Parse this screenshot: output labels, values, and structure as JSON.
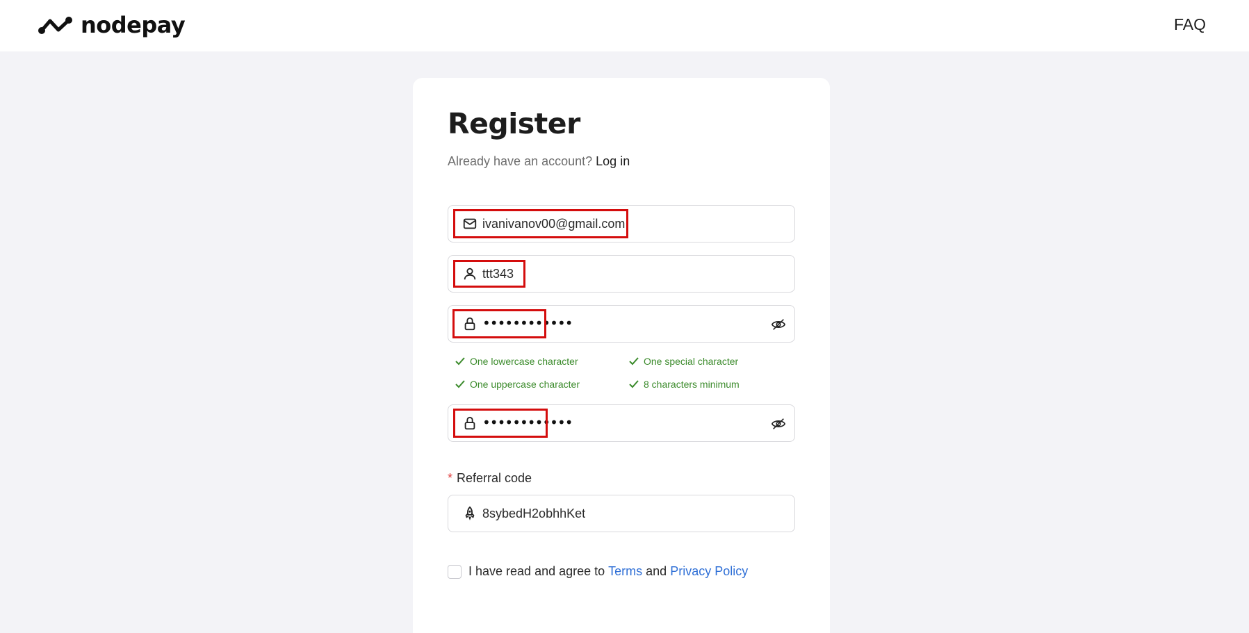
{
  "header": {
    "logo_text": "nodepay",
    "faq_label": "FAQ"
  },
  "form": {
    "title": "Register",
    "subtitle_text": "Already have an account? ",
    "login_link": "Log in",
    "email_value": "ivanivanov00@gmail.com",
    "username_value": "ttt343",
    "password_value": "••••••••••••",
    "confirm_password_value": "••••••••••••",
    "requirements": [
      "One lowercase character",
      "One special character",
      "One uppercase character",
      "8 characters minimum"
    ],
    "referral_required_mark": "*",
    "referral_label": "Referral code",
    "referral_value": "8sybedH2obhhKet",
    "agree_prefix": "I have read and agree to ",
    "terms_link": "Terms",
    "agree_and": " and ",
    "privacy_link": "Privacy Policy"
  },
  "colors": {
    "page_bg": "#f3f3f7",
    "requirement_green": "#3a8a2a",
    "link_blue": "#2f6fd6",
    "highlight_red": "#d40d0d"
  }
}
